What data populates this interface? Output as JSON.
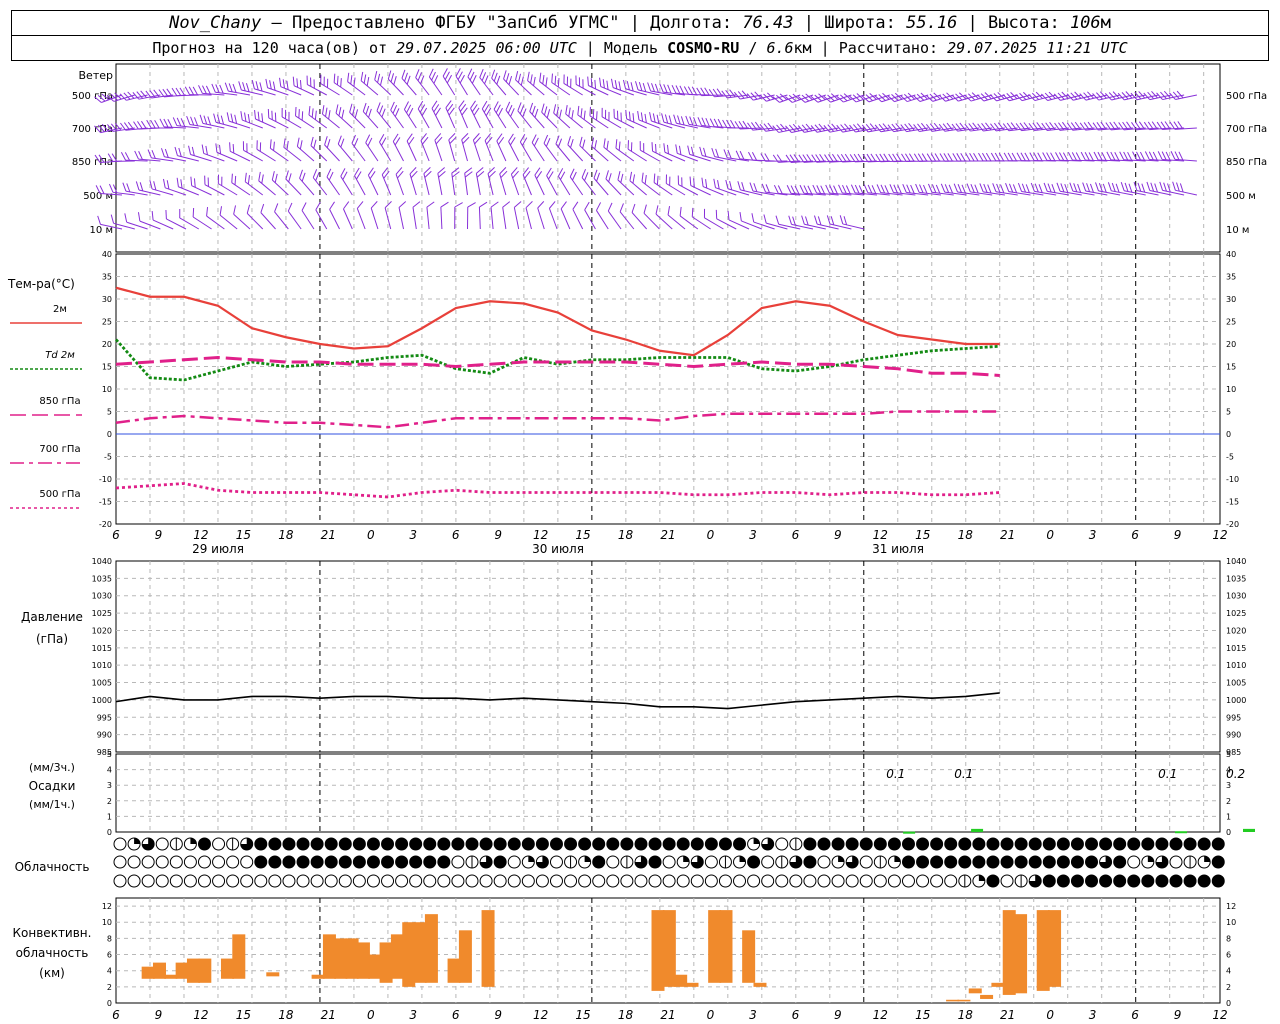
{
  "header": {
    "station": "Nov_Chany",
    "provider": "Предоставлено ФГБУ \"ЗапСиб УГМС\"",
    "lon_label": "Долгота:",
    "lon": "76.43",
    "lat_label": "Широта:",
    "lat": "55.16",
    "alt_label": "Высота:",
    "alt": "106",
    "alt_unit": "м",
    "forecast_prefix": "Прогноз на 120 часа(ов) от",
    "forecast_start": "29.07.2025 06:00 UTC",
    "model_label": "Модель",
    "model": "COSMO-RU",
    "resolution": "6.6",
    "resolution_unit": "км",
    "computed_label": "Рассчитано:",
    "computed": "29.07.2025 11:21 UTC"
  },
  "colors": {
    "t2m": "#e8403a",
    "td2m": "#138a13",
    "t850": "#e0208a",
    "t700": "#e0208a",
    "t500": "#e0208a",
    "pressure": "#000000",
    "precip": "#22cc22",
    "convective": "#f08a2c",
    "wind": "#8830d8",
    "zero_line": "#3050e0"
  },
  "chart_data": [
    {
      "type": "wind_barbs",
      "title": "Ветер",
      "levels": [
        "500 гПа",
        "700 гПа",
        "850 гПа",
        "500 м",
        "10 м"
      ],
      "x_hours_from_start": [
        0,
        30,
        60,
        90,
        102
      ]
    },
    {
      "type": "line",
      "ylabel": "Тем-ра(°C)",
      "ylim": [
        -20,
        40
      ],
      "yticks": [
        -20,
        -15,
        -10,
        -5,
        0,
        5,
        10,
        15,
        20,
        25,
        30,
        35,
        40
      ],
      "x_tick_labels": [
        "6",
        "9",
        "12",
        "15",
        "18",
        "21",
        "0",
        "3",
        "6",
        "9",
        "12",
        "15",
        "18",
        "21",
        "0",
        "3",
        "6",
        "9",
        "12",
        "15",
        "18",
        "21",
        "0",
        "3",
        "6",
        "9",
        "12"
      ],
      "day_labels": [
        "29 июля",
        "30 июля",
        "31 июля"
      ],
      "x_hours": [
        0,
        3,
        6,
        9,
        12,
        15,
        18,
        21,
        24,
        27,
        30,
        33,
        36,
        39,
        42,
        45,
        48,
        51,
        54,
        57,
        60,
        63,
        66,
        69,
        72,
        75,
        78
      ],
      "series": [
        {
          "name": "2м",
          "style": "solid",
          "values": [
            32.5,
            30.5,
            30.5,
            28.5,
            23.5,
            21.5,
            20.0,
            19.0,
            19.5,
            23.5,
            28.0,
            29.5,
            29.0,
            27.0,
            23.0,
            21.0,
            18.5,
            17.5,
            22.0,
            28.0,
            29.5,
            28.5,
            25.0,
            22.0,
            21.0,
            20.0,
            20.0
          ]
        },
        {
          "name": "Td 2м",
          "style": "dotted",
          "values": [
            21.0,
            12.5,
            12.0,
            14.0,
            16.0,
            15.0,
            15.5,
            16.0,
            17.0,
            17.5,
            14.5,
            13.5,
            17.0,
            15.5,
            16.5,
            16.5,
            17.0,
            17.0,
            17.0,
            14.5,
            14.0,
            15.0,
            16.5,
            17.5,
            18.5,
            19.0,
            19.5
          ]
        },
        {
          "name": "850 гПа",
          "style": "dash",
          "values": [
            15.5,
            16.0,
            16.5,
            17.0,
            16.5,
            16.0,
            16.0,
            15.5,
            15.5,
            15.5,
            15.0,
            15.5,
            16.0,
            16.0,
            16.0,
            16.0,
            15.5,
            15.0,
            15.5,
            16.0,
            15.5,
            15.5,
            15.0,
            14.5,
            13.5,
            13.5,
            13.0
          ]
        },
        {
          "name": "700 гПа",
          "style": "dashdot",
          "values": [
            2.5,
            3.5,
            4.0,
            3.5,
            3.0,
            2.5,
            2.5,
            2.0,
            1.5,
            2.5,
            3.5,
            3.5,
            3.5,
            3.5,
            3.5,
            3.5,
            3.0,
            4.0,
            4.5,
            4.5,
            4.5,
            4.5,
            4.5,
            5.0,
            5.0,
            5.0,
            5.0
          ]
        },
        {
          "name": "500 гПа",
          "style": "dotted",
          "values": [
            -12.0,
            -11.5,
            -11.0,
            -12.5,
            -13.0,
            -13.0,
            -13.0,
            -13.5,
            -14.0,
            -13.0,
            -12.5,
            -13.0,
            -13.0,
            -13.0,
            -13.0,
            -13.0,
            -13.0,
            -13.5,
            -13.5,
            -13.0,
            -13.0,
            -13.5,
            -13.0,
            -13.0,
            -13.5,
            -13.5,
            -13.0
          ]
        }
      ]
    },
    {
      "type": "line",
      "ylabel": "Давление",
      "yunit": "(гПа)",
      "ylim": [
        985,
        1040
      ],
      "yticks": [
        985,
        990,
        995,
        1000,
        1005,
        1010,
        1015,
        1020,
        1025,
        1030,
        1035,
        1040
      ],
      "x_hours": [
        0,
        3,
        6,
        9,
        12,
        15,
        18,
        21,
        24,
        27,
        30,
        33,
        36,
        39,
        42,
        45,
        48,
        51,
        54,
        57,
        60,
        63,
        66,
        69,
        72,
        75,
        78
      ],
      "series": [
        {
          "name": "",
          "values": [
            999.5,
            1001,
            1000,
            1000,
            1001,
            1001,
            1000.5,
            1001,
            1001,
            1000.5,
            1000.5,
            1000,
            1000.5,
            1000,
            999.5,
            999,
            998,
            998,
            997.5,
            998.5,
            999.5,
            1000,
            1000.5,
            1001,
            1000.5,
            1001,
            1002
          ]
        }
      ]
    },
    {
      "type": "bar",
      "ylabel": "Осадки",
      "yunit_top": "(мм/3ч.)",
      "yunit_bottom": "(мм/1ч.)",
      "ylim": [
        0,
        5
      ],
      "yticks": [
        0,
        1,
        2,
        3,
        4,
        5
      ],
      "annotations": [
        {
          "x_hour": 69,
          "label": "0.1"
        },
        {
          "x_hour": 75,
          "label": "0.1"
        },
        {
          "x_hour": 93,
          "label": "0.1"
        },
        {
          "x_hour": 99,
          "label": "0.2"
        }
      ],
      "bars": [
        {
          "x_hour": 70,
          "value": 0.02
        },
        {
          "x_hour": 76,
          "value": 0.2
        },
        {
          "x_hour": 94,
          "value": 0.05
        },
        {
          "x_hour": 100,
          "value": 0.2
        }
      ]
    },
    {
      "type": "cloud_cover",
      "ylabel": "Облачность",
      "rows": 3
    },
    {
      "type": "bar",
      "ylabel": "Конвективн.",
      "ylabel2": "облачность",
      "yunit": "(км)",
      "ylim": [
        0,
        13
      ],
      "yticks": [
        0,
        2,
        4,
        6,
        8,
        10,
        12
      ],
      "bars": [
        {
          "x_hour": 2,
          "bottom": 3.0,
          "top": 4.5
        },
        {
          "x_hour": 3,
          "bottom": 3.0,
          "top": 5.0
        },
        {
          "x_hour": 4,
          "bottom": 3.0,
          "top": 3.5
        },
        {
          "x_hour": 5,
          "bottom": 3.0,
          "top": 5.0
        },
        {
          "x_hour": 6,
          "bottom": 2.5,
          "top": 5.5
        },
        {
          "x_hour": 7,
          "bottom": 2.5,
          "top": 5.5
        },
        {
          "x_hour": 9,
          "bottom": 3.0,
          "top": 5.5
        },
        {
          "x_hour": 10,
          "bottom": 3.0,
          "top": 8.5
        },
        {
          "x_hour": 13,
          "bottom": 3.3,
          "top": 3.8
        },
        {
          "x_hour": 17,
          "bottom": 3.0,
          "top": 3.5
        },
        {
          "x_hour": 18,
          "bottom": 3.0,
          "top": 8.5
        },
        {
          "x_hour": 19,
          "bottom": 3.0,
          "top": 8.0
        },
        {
          "x_hour": 20,
          "bottom": 3.0,
          "top": 8.0
        },
        {
          "x_hour": 21,
          "bottom": 3.0,
          "top": 7.5
        },
        {
          "x_hour": 22,
          "bottom": 3.0,
          "top": 6.0
        },
        {
          "x_hour": 23,
          "bottom": 2.5,
          "top": 7.5
        },
        {
          "x_hour": 24,
          "bottom": 3.0,
          "top": 8.5
        },
        {
          "x_hour": 25,
          "bottom": 2.0,
          "top": 10.0
        },
        {
          "x_hour": 26,
          "bottom": 2.5,
          "top": 10.0
        },
        {
          "x_hour": 27,
          "bottom": 2.5,
          "top": 11.0
        },
        {
          "x_hour": 29,
          "bottom": 2.5,
          "top": 5.5
        },
        {
          "x_hour": 30,
          "bottom": 2.5,
          "top": 9.0
        },
        {
          "x_hour": 32,
          "bottom": 2.0,
          "top": 11.5
        },
        {
          "x_hour": 47,
          "bottom": 1.5,
          "top": 11.5
        },
        {
          "x_hour": 48,
          "bottom": 2.0,
          "top": 11.5
        },
        {
          "x_hour": 49,
          "bottom": 2.0,
          "top": 3.5
        },
        {
          "x_hour": 50,
          "bottom": 2.0,
          "top": 2.5
        },
        {
          "x_hour": 52,
          "bottom": 2.5,
          "top": 11.5
        },
        {
          "x_hour": 53,
          "bottom": 2.5,
          "top": 11.5
        },
        {
          "x_hour": 55,
          "bottom": 2.5,
          "top": 9.0
        },
        {
          "x_hour": 56,
          "bottom": 2.0,
          "top": 2.5
        },
        {
          "x_hour": 73,
          "bottom": 0.2,
          "top": 0.4
        },
        {
          "x_hour": 74,
          "bottom": 0.2,
          "top": 0.4
        },
        {
          "x_hour": 75,
          "bottom": 1.2,
          "top": 1.8
        },
        {
          "x_hour": 76,
          "bottom": 0.5,
          "top": 1.0
        },
        {
          "x_hour": 77,
          "bottom": 2.0,
          "top": 2.5
        },
        {
          "x_hour": 78,
          "bottom": 1.0,
          "top": 11.5
        },
        {
          "x_hour": 79,
          "bottom": 1.2,
          "top": 11.0
        },
        {
          "x_hour": 81,
          "bottom": 1.5,
          "top": 11.5
        },
        {
          "x_hour": 82,
          "bottom": 2.0,
          "top": 11.5
        }
      ]
    }
  ]
}
